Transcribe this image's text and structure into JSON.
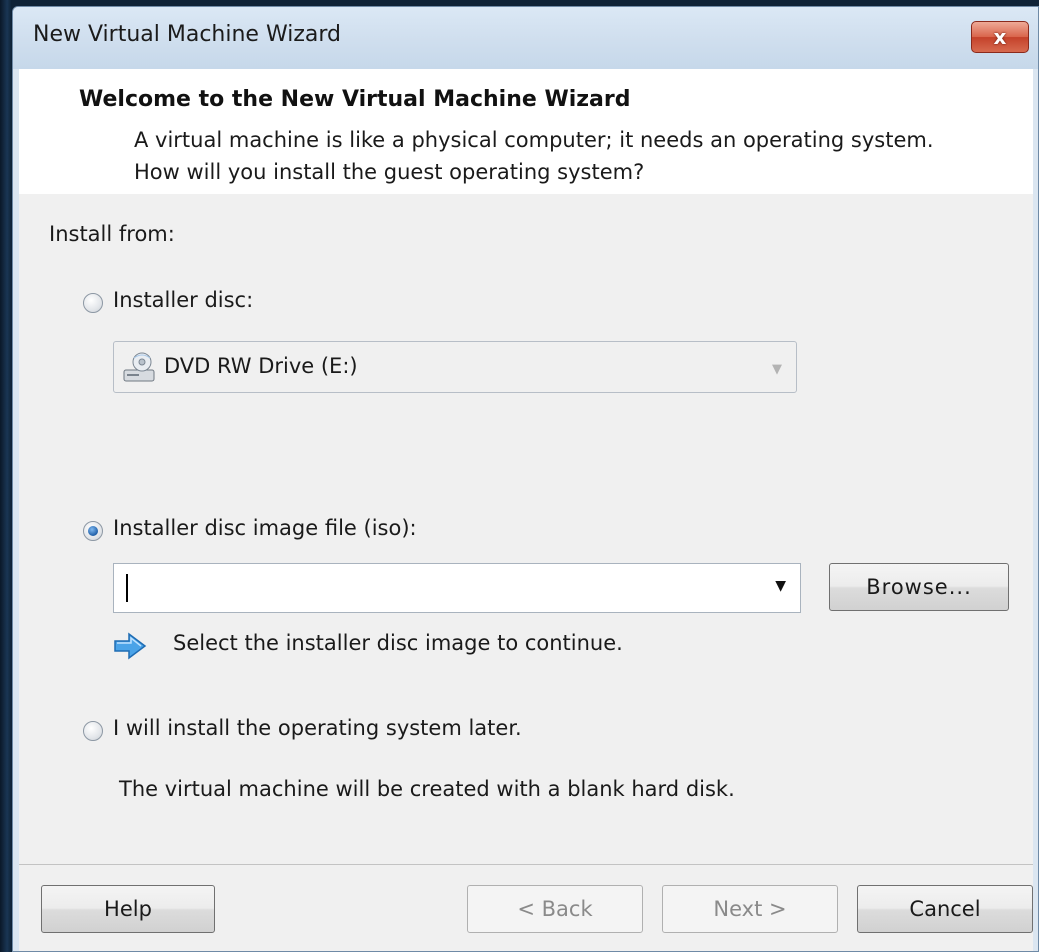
{
  "window": {
    "title": "New Virtual Machine Wizard",
    "close_label": "x"
  },
  "header": {
    "title": "Welcome to the New Virtual Machine Wizard",
    "description": "A virtual machine is like a physical computer; it needs an operating system. How will you install the guest operating system?"
  },
  "install": {
    "section_label": "Install from:",
    "installer_disc": {
      "label": "Installer disc:",
      "selected": false,
      "drive_value": "DVD RW Drive (E:)",
      "drive_icon": "dvd-drive-icon"
    },
    "iso": {
      "label": "Installer disc image file (iso):",
      "selected": true,
      "path_value": "",
      "browse_label": "Browse...",
      "hint": "Select the installer disc image to continue.",
      "hint_icon": "info-arrow-icon"
    },
    "later": {
      "label": "I will install the operating system later.",
      "selected": false,
      "description": "The virtual machine will be created with a blank hard disk."
    }
  },
  "footer": {
    "help_label": "Help",
    "back_label": "< Back",
    "next_label": "Next >",
    "cancel_label": "Cancel"
  }
}
